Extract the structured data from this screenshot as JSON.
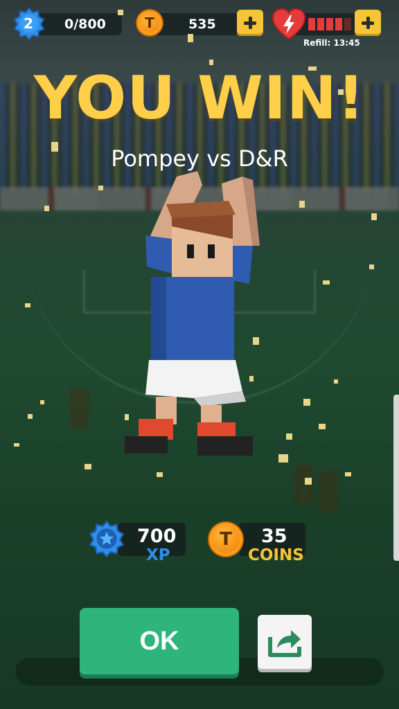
{
  "hud": {
    "level": "2",
    "xp_progress": "0/800",
    "coins": "535",
    "coin_symbol": "T",
    "energy_fill_fraction": 0.8,
    "refill_label": "Refill: 13:45"
  },
  "result": {
    "title": "YOU WIN!",
    "match": "Pompey vs D&R"
  },
  "rewards": {
    "xp_amount": "700",
    "xp_label": "XP",
    "coins_amount": "35",
    "coins_label": "COINS"
  },
  "actions": {
    "ok_label": "OK"
  },
  "colors": {
    "accent_yellow": "#ffcf4a",
    "ok_green": "#2fb57b",
    "xp_blue": "#2f8ee8",
    "coin_orange": "#f28a10",
    "heart_red": "#e63b3b"
  },
  "icons": {
    "level_badge": "star-badge-icon",
    "coin": "coin-icon",
    "energy": "heart-lightning-icon",
    "add": "plus-icon",
    "share": "share-icon"
  }
}
